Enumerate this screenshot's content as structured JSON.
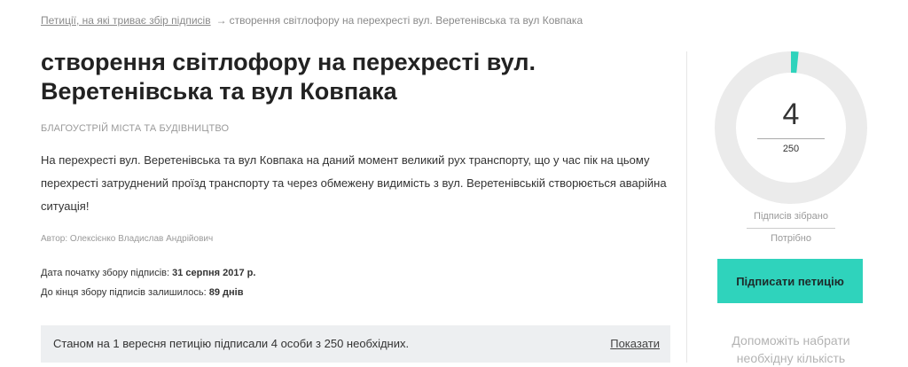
{
  "breadcrumb": {
    "parent": "Петиції, на які триває збір підписів",
    "arrow": "→",
    "current": "створення світлофору на перехресті вул. Веретенівська та вул Ковпака"
  },
  "petition": {
    "title": "створення світлофору на перехресті вул. Веретенівська та вул Ковпака",
    "category": "БЛАГОУСТРІЙ МІСТА ТА БУДІВНИЦТВО",
    "description": "На перехресті вул. Веретенівська та вул Ковпака на даний момент великий рух транспорту, що у час пік на цьому перехресті затруднений проїзд транспорту та через обмежену видимість з вул. Веретенівській створюється аварійна ситуація!",
    "author": "Автор: Олексієнко Владислав Андрійович",
    "start_label": "Дата початку збору підписів: ",
    "start_value": "31 серпня 2017 р.",
    "remaining_label": "До кінця збору підписів залишилось: ",
    "remaining_value": "89 днів"
  },
  "status": {
    "text": "Станом на 1 вересня петицію підписали 4 особи з 250 необхідних.",
    "show_link": "Показати"
  },
  "progress": {
    "collected": "4",
    "required": "250",
    "fraction": 0.016,
    "collected_label": "Підписів зібрано",
    "required_label": "Потрібно",
    "ring_color": "#2fd3bc",
    "track_color": "#ebebeb"
  },
  "sidebar": {
    "sign_button": "Підписати петицію",
    "help_text": "Допоможіть набрати необхідну кількість"
  }
}
